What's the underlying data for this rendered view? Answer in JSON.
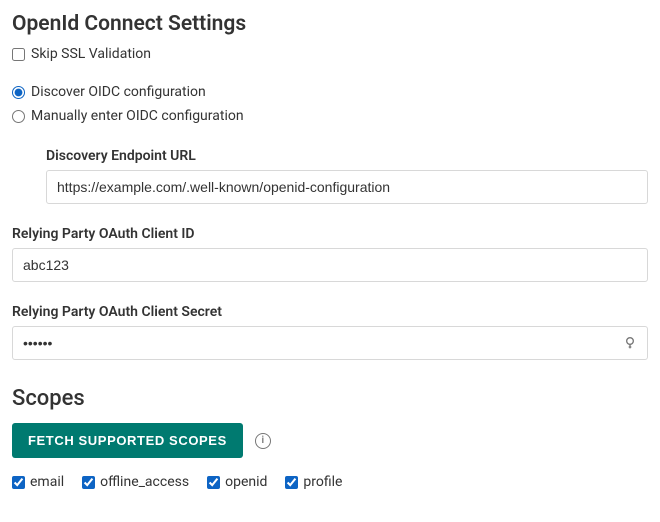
{
  "heading": "OpenId Connect Settings",
  "skip_ssl_label": "Skip SSL Validation",
  "skip_ssl_checked": false,
  "discover_label": "Discover OIDC configuration",
  "manual_label": "Manually enter OIDC configuration",
  "config_mode": "discover",
  "discovery_url_label": "Discovery Endpoint URL",
  "discovery_url_value": "https://example.com/.well-known/openid-configuration",
  "client_id_label": "Relying Party OAuth Client ID",
  "client_id_value": "abc123",
  "client_secret_label": "Relying Party OAuth Client Secret",
  "client_secret_value": "••••••",
  "scopes_heading": "Scopes",
  "fetch_button_label": "FETCH SUPPORTED SCOPES",
  "scopes": [
    {
      "name": "email",
      "checked": true
    },
    {
      "name": "offline_access",
      "checked": true
    },
    {
      "name": "openid",
      "checked": true
    },
    {
      "name": "profile",
      "checked": true
    }
  ]
}
